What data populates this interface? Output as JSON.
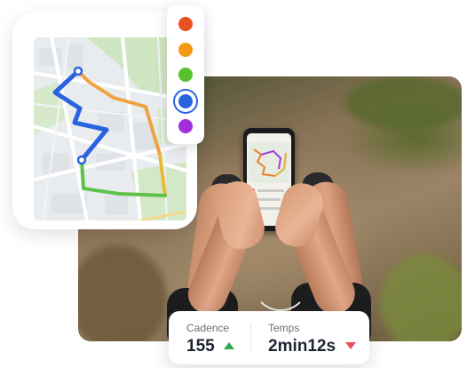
{
  "color_picker": {
    "options": [
      {
        "name": "red",
        "color": "#e8501f"
      },
      {
        "name": "orange",
        "color": "#f29a12"
      },
      {
        "name": "green",
        "color": "#57c22c"
      },
      {
        "name": "blue",
        "color": "#2a63e0",
        "selected": true
      },
      {
        "name": "purple",
        "color": "#a22fdb"
      }
    ]
  },
  "route": {
    "segment_colors": [
      "#2a63e0",
      "#f0a240",
      "#e8b83a",
      "#5ec24a"
    ]
  },
  "stats": {
    "cadence": {
      "label": "Cadence",
      "value": "155",
      "trend": "up",
      "trend_color": "#2fa84f"
    },
    "time": {
      "label": "Temps",
      "value": "2min12s",
      "trend": "down",
      "trend_color": "#e5525d"
    }
  }
}
